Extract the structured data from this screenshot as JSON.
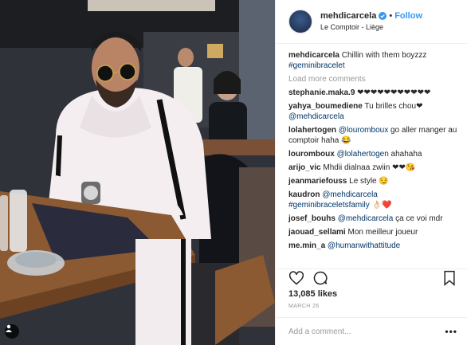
{
  "post": {
    "username": "mehdicarcela",
    "follow_label": "Follow",
    "dot": "•",
    "location": "Le Comptoir - Liège",
    "likes": "13,085 likes",
    "date": "MARCH 26",
    "add_comment_placeholder": "Add a comment...",
    "more_label": "•••",
    "load_more": "Load more comments"
  },
  "caption": {
    "user": "mehdicarcela",
    "text": "Chillin with them boyzzz",
    "hashtag": "#geminibracelet"
  },
  "comments": [
    {
      "user": "stephanie.maka.9",
      "text": "❤❤❤❤❤❤❤❤❤❤❤",
      "link": ""
    },
    {
      "user": "yahya_boumediene",
      "text": "Tu brilles chou❤",
      "link": "@mehdicarcela"
    },
    {
      "user": "lolahertogen",
      "text": "go aller manger au comptoir haha 😂",
      "link": "@louromboux",
      "link_first": true
    },
    {
      "user": "louromboux",
      "text": "ahahaha",
      "link": "@lolahertogen",
      "link_first": true
    },
    {
      "user": "arijo_vic",
      "text": "Mhdii dialnaa zwiin ❤❤😘",
      "link": ""
    },
    {
      "user": "jeanmariefouss",
      "text": "Le style 😏",
      "link": ""
    },
    {
      "user": "kaudron",
      "text": "👌🏻❤️",
      "link": "@mehdicarcela #geminibraceletsfamily",
      "link_first": true
    },
    {
      "user": "josef_bouhs",
      "text": "ça ce voi mdr",
      "link": "@mehdicarcela",
      "link_first": true
    },
    {
      "user": "jaouad_sellami",
      "text": "Mon meilleur joueur",
      "link": ""
    },
    {
      "user": "me.min_a",
      "text": "",
      "link": "@humanwithattitude",
      "link_first": true
    }
  ],
  "colors": {
    "link": "#003569",
    "follow": "#3897f0",
    "verified": "#3897f0",
    "muted": "#999999"
  }
}
